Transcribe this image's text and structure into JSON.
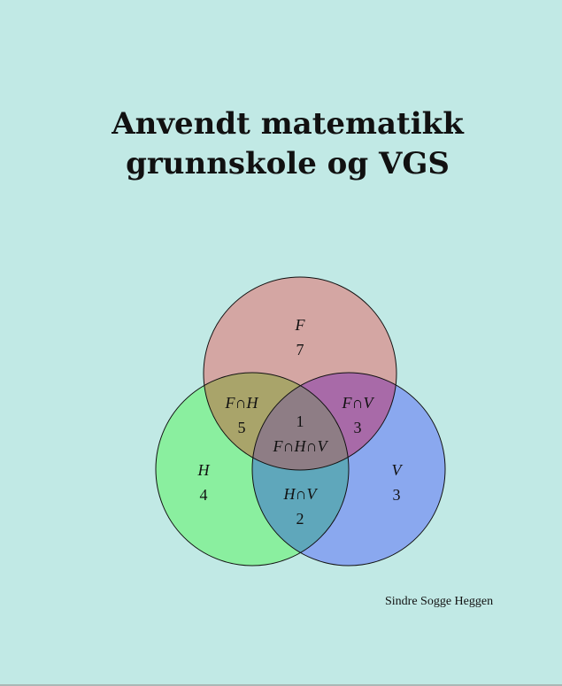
{
  "title": {
    "line1": "Anvendt matematikk",
    "line2": "grunnskole og VGS"
  },
  "colors": {
    "background": "#c1e9e5",
    "F": "#d4a6a3",
    "H": "#8aef9f",
    "V": "#8aa8ef",
    "F_and_H": "#a9a46a",
    "F_and_V": "#a86aa8",
    "H_and_V": "#5fa7bb",
    "F_and_H_and_V": "#8e7d85"
  },
  "venn": {
    "F": {
      "label": "F",
      "count": "7"
    },
    "H": {
      "label": "H",
      "count": "4"
    },
    "V": {
      "label": "V",
      "count": "3"
    },
    "F_and_H": {
      "label": "F∩H",
      "count": "5"
    },
    "F_and_V": {
      "label": "F∩V",
      "count": "3"
    },
    "H_and_V": {
      "label": "H∩V",
      "count": "2"
    },
    "F_and_H_and_V": {
      "label": "F∩H∩V",
      "count": "1"
    }
  },
  "author": "Sindre Sogge Heggen"
}
